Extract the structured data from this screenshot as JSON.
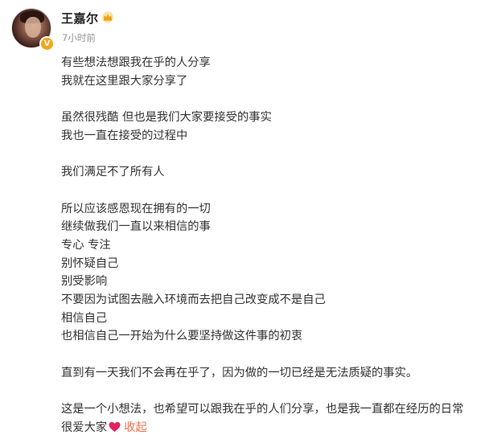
{
  "author": {
    "name": "王嘉尔",
    "time": "7小时前",
    "verified_badge": "V",
    "avatar_icon": "user-avatar",
    "badge_icon": "crown-icon",
    "badge_color": "#f3a71a"
  },
  "post": {
    "paragraphs": [
      [
        "有些想法想跟我在乎的人分享",
        "我就在这里跟大家分享了"
      ],
      [
        "虽然很残酷 但也是我们大家要接受的事实",
        "我也一直在接受的过程中"
      ],
      [
        "我们满足不了所有人"
      ],
      [
        "所以应该感恩现在拥有的一切",
        "继续做我们一直以来相信的事",
        "专心 专注",
        "别怀疑自己",
        "别受影响",
        "不要因为试图去融入环境而去把自己改变成不是自己",
        "相信自己",
        "也相信自己一开始为什么要坚持做这件事的初衷"
      ],
      [
        "直到有一天我们不会再在乎了，因为做的一切已经是无法质疑的事实。"
      ],
      [
        "这是一个小想法，也希望可以跟我在乎的人们分享，也是我一直都在经历的日常"
      ]
    ],
    "closing_text": "很爱大家",
    "closing_icon": "heart-icon",
    "heart_color": "#e0245e",
    "collapse_label": "收起",
    "collapse_color": "#eb7350"
  }
}
